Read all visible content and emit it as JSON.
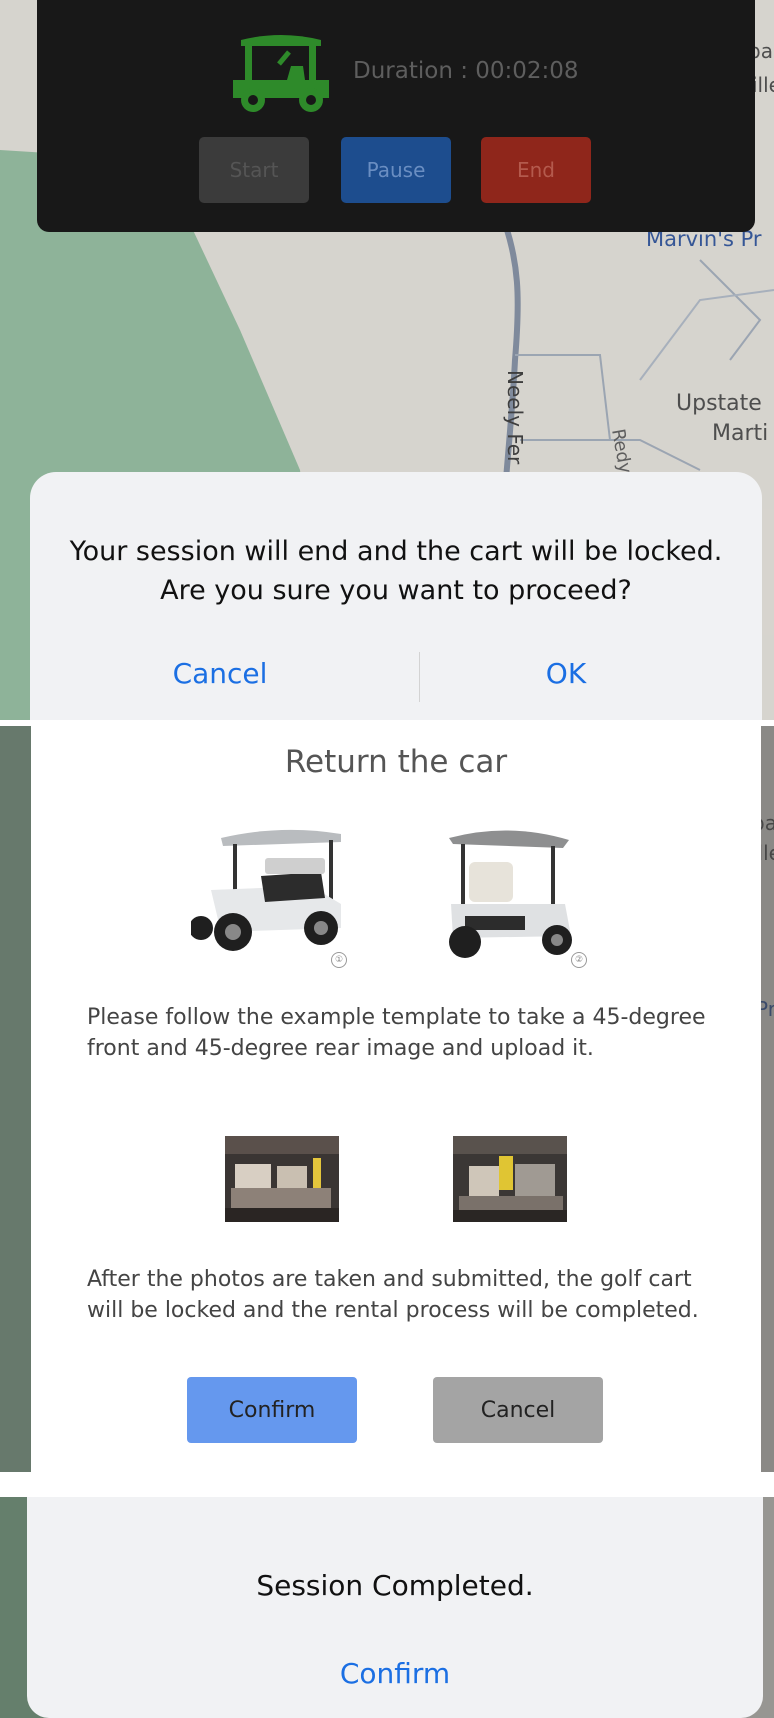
{
  "timer": {
    "duration_text": "Duration : 00:02:08",
    "start_label": "Start",
    "pause_label": "Pause",
    "end_label": "End",
    "icon": "golf-cart-icon",
    "colors": {
      "cart": "#2e8a2a",
      "start": "#3b3b3b",
      "pause": "#1d4d8e",
      "end": "#8f261b"
    }
  },
  "map": {
    "labels": [
      "Marvin's Pr",
      "Neely Fer",
      "Redy",
      "Upstate",
      "Marti",
      "pa",
      "ille"
    ]
  },
  "end_alert": {
    "message_line1": "Your session will end and the cart will be locked.",
    "message_line2": "Are you sure you want to proceed?",
    "cancel_label": "Cancel",
    "ok_label": "OK"
  },
  "return_modal": {
    "title": "Return the car",
    "example_numbers": [
      "①",
      "②"
    ],
    "instruction": "Please follow the example template to take a 45-degree front and 45-degree rear image and upload it.",
    "note": "After the photos are taken and submitted, the golf cart will be locked and the rental process will be completed.",
    "confirm_label": "Confirm",
    "cancel_label": "Cancel"
  },
  "completed_alert": {
    "message": "Session Completed.",
    "confirm_label": "Confirm"
  },
  "accent_color": "#1b6fe3"
}
